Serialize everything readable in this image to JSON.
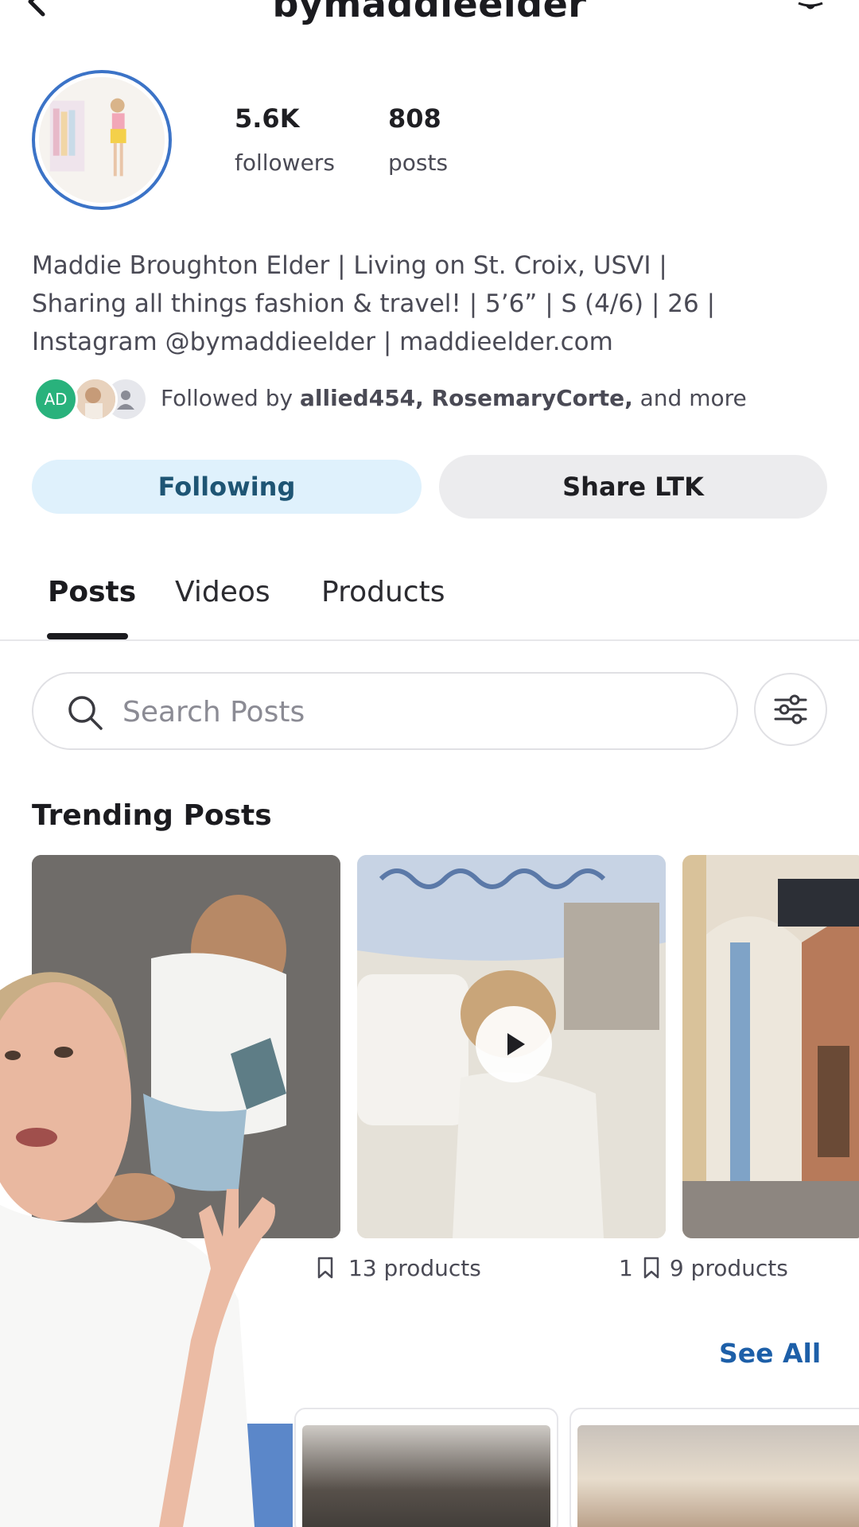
{
  "header": {
    "title": "bymaddieelder"
  },
  "profile": {
    "followers_count": "5.6K",
    "followers_label": "followers",
    "posts_count": "808",
    "posts_label": "posts",
    "bio": [
      "Maddie Broughton Elder | Living on St. Croix, USVI |",
      "Sharing all things fashion & travel! | 5’6” | S (4/6) | 26 |",
      "Instagram @bymaddieelder | maddieelder.com"
    ],
    "followed_by": {
      "prefix": "Followed by ",
      "names": "allied454, RosemaryCorte,",
      "suffix": " and more",
      "avatar_initials": "AD"
    }
  },
  "actions": {
    "following_label": "Following",
    "share_label": "Share LTK"
  },
  "tabs": [
    {
      "label": "Posts",
      "active": true
    },
    {
      "label": "Videos",
      "active": false
    },
    {
      "label": "Products",
      "active": false
    }
  ],
  "search": {
    "placeholder": "Search Posts"
  },
  "trending": {
    "title": "Trending Posts",
    "items": [
      {
        "products": ""
      },
      {
        "products": "13 products",
        "is_video": true
      },
      {
        "saves": "1",
        "products": "9 products"
      }
    ]
  },
  "see_all_label": "See All",
  "colors": {
    "accent_blue": "#1d5fa8",
    "following_bg": "#dff1fc",
    "avatar_ring": "#3b73c7",
    "ad_avatar": "#29b27c"
  }
}
